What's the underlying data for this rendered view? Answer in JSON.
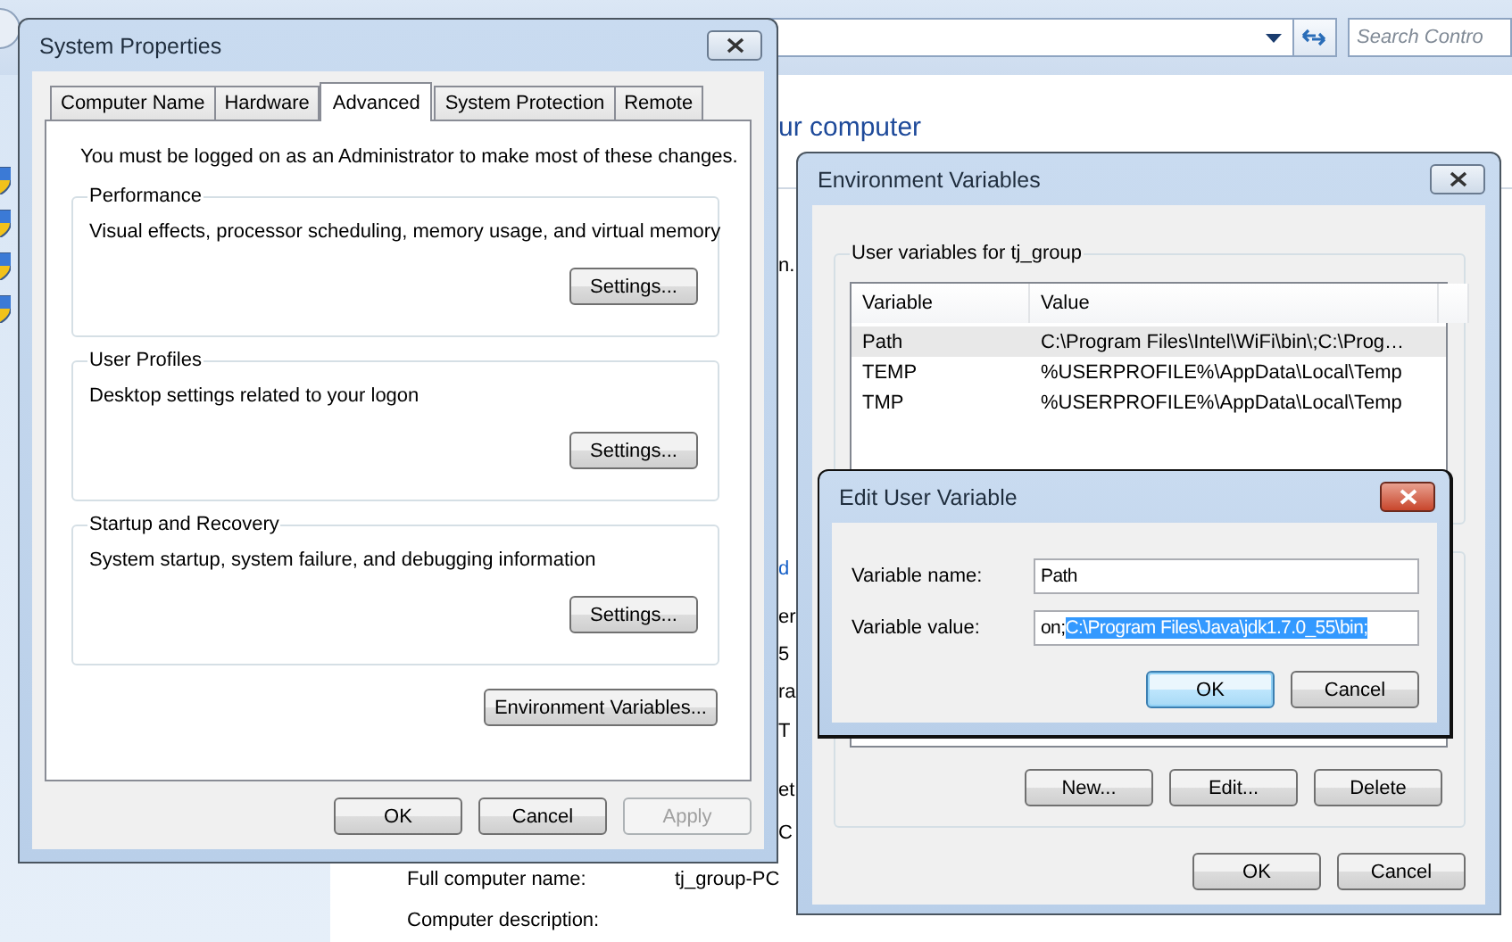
{
  "control_panel": {
    "search_placeholder": "Search Contro",
    "heading": "ur computer",
    "cut_texts": [
      {
        "text": "n.",
        "kind": "plain"
      },
      {
        "text": "d",
        "kind": "link"
      },
      {
        "text": "er",
        "kind": "plain"
      },
      {
        "text": "5",
        "kind": "plain"
      },
      {
        "text": "ra",
        "kind": "plain"
      },
      {
        "text": "T",
        "kind": "plain"
      },
      {
        "text": "et",
        "kind": "plain"
      },
      {
        "text": "C",
        "kind": "plain"
      }
    ],
    "rows": [
      {
        "label": "Full computer name:",
        "value": "tj_group-PC"
      },
      {
        "label": "Computer description:"
      }
    ]
  },
  "system_properties": {
    "title": "System Properties",
    "tabs": [
      {
        "label": "Computer Name",
        "selected": false
      },
      {
        "label": "Hardware",
        "selected": false
      },
      {
        "label": "Advanced",
        "selected": true
      },
      {
        "label": "System Protection",
        "selected": false
      },
      {
        "label": "Remote",
        "selected": false
      }
    ],
    "notice": "You must be logged on as an Administrator to make most of these changes.",
    "groups": [
      {
        "title": "Performance",
        "description": "Visual effects, processor scheduling, memory usage, and virtual memory",
        "button": "Settings..."
      },
      {
        "title": "User Profiles",
        "description": "Desktop settings related to your logon",
        "button": "Settings..."
      },
      {
        "title": "Startup and Recovery",
        "description": "System startup, system failure, and debugging information",
        "button": "Settings..."
      }
    ],
    "env_button": "Environment Variables...",
    "buttons": [
      {
        "label": "OK",
        "disabled": false
      },
      {
        "label": "Cancel",
        "disabled": false
      },
      {
        "label": "Apply",
        "disabled": true
      }
    ]
  },
  "environment_variables": {
    "title": "Environment Variables",
    "user_group": "User variables for tj_group",
    "columns": [
      "Variable",
      "Value"
    ],
    "rows": [
      {
        "variable": "Path",
        "value": "C:\\Program Files\\Intel\\WiFi\\bin\\;C:\\Prog…",
        "selected": true
      },
      {
        "variable": "TEMP",
        "value": "%USERPROFILE%\\AppData\\Local\\Temp",
        "selected": false
      },
      {
        "variable": "TMP",
        "value": "%USERPROFILE%\\AppData\\Local\\Temp",
        "selected": false
      }
    ],
    "system_buttons": [
      "New...",
      "Edit...",
      "Delete"
    ],
    "buttons": [
      "OK",
      "Cancel"
    ]
  },
  "edit_user_variable": {
    "title": "Edit User Variable",
    "fields": [
      {
        "label": "Variable name:",
        "value": "Path"
      },
      {
        "label": "Variable value:",
        "value": "on;",
        "selection": "C:\\Program Files\\Java\\jdk1.7.0_55\\bin;"
      }
    ],
    "buttons": [
      {
        "label": "OK",
        "focused": true
      },
      {
        "label": "Cancel",
        "focused": false
      }
    ]
  }
}
